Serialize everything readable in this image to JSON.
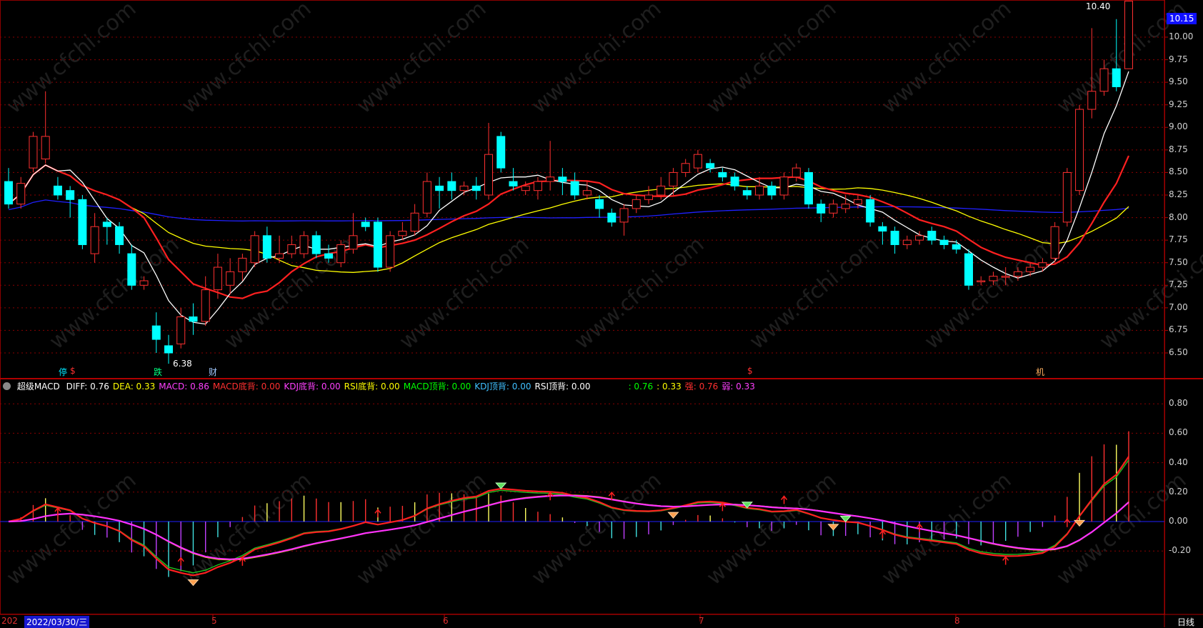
{
  "price_panel": {
    "high_marker": "10.40",
    "low_marker": "6.38",
    "current_price": "10.15",
    "y_axis": [
      "10.00",
      "9.75",
      "9.50",
      "9.25",
      "9.00",
      "8.75",
      "8.50",
      "8.25",
      "8.00",
      "7.75",
      "7.50",
      "7.25",
      "7.00",
      "6.75",
      "6.50"
    ],
    "signal_labels": [
      {
        "text": "停",
        "color": "#00e5ff"
      },
      {
        "text": "$",
        "color": "#ff3030"
      },
      {
        "text": "跌",
        "color": "#00ff80"
      },
      {
        "text": "财",
        "color": "#a0c8ff"
      },
      {
        "text": "$",
        "color": "#ff3030"
      },
      {
        "text": "机",
        "color": "#ffb060"
      }
    ],
    "watermark": "www.cfchi.com"
  },
  "indicator_panel": {
    "name": "超级MACD",
    "stats": [
      {
        "label": "DIFF: 0.76",
        "color": "#ffffff"
      },
      {
        "label": "DEA: 0.33",
        "color": "#ffff00"
      },
      {
        "label": "MACD: 0.86",
        "color": "#ff40ff"
      },
      {
        "label": "MACD底背: 0.00",
        "color": "#ff3030"
      },
      {
        "label": "KDJ底背: 0.00",
        "color": "#ff40ff"
      },
      {
        "label": "RSI底背: 0.00",
        "color": "#ffff00"
      },
      {
        "label": "MACD顶背: 0.00",
        "color": "#00ff00"
      },
      {
        "label": "KDJ顶背: 0.00",
        "color": "#40c0ff"
      },
      {
        "label": "RSI顶背: 0.00",
        "color": "#ffffff"
      },
      {
        "label": ": 0.76",
        "color": "#00ff00"
      },
      {
        "label": ": 0.33",
        "color": "#ffff00"
      },
      {
        "label": "强: 0.76",
        "color": "#ff3030"
      },
      {
        "label": "弱: 0.33",
        "color": "#ff40ff"
      }
    ],
    "y_axis": [
      "0.80",
      "0.60",
      "0.40",
      "0.20",
      "0.00",
      "-0.20"
    ]
  },
  "bottom_bar": {
    "date_prefix": "202",
    "date": "2022/03/30/三",
    "months": [
      "5",
      "6",
      "7",
      "8"
    ],
    "period": "日线"
  },
  "colors": {
    "up": "#ff3030",
    "down": "#00ffff",
    "ma5": "#ffffff",
    "ma10": "#ff2020",
    "ma20": "#ffff00",
    "ma60": "#2020ff",
    "grid": "#8b0000"
  },
  "chart_data": {
    "type": "candlestick",
    "y_range": [
      6.38,
      10.4
    ],
    "candles": [
      [
        8.4,
        8.15,
        8.55,
        8.1
      ],
      [
        8.15,
        8.38,
        8.45,
        8.1
      ],
      [
        8.55,
        8.9,
        8.95,
        8.5
      ],
      [
        8.65,
        8.9,
        9.4,
        8.6
      ],
      [
        8.35,
        8.25,
        8.45,
        8.2
      ],
      [
        8.3,
        8.2,
        8.35,
        8.0
      ],
      [
        8.2,
        7.7,
        8.25,
        7.65
      ],
      [
        7.6,
        7.9,
        8.05,
        7.5
      ],
      [
        7.95,
        7.9,
        8.0,
        7.7
      ],
      [
        7.9,
        7.7,
        7.95,
        7.6
      ],
      [
        7.6,
        7.25,
        7.7,
        7.2
      ],
      [
        7.25,
        7.3,
        7.35,
        7.2
      ],
      [
        6.8,
        6.65,
        6.95,
        6.5
      ],
      [
        6.58,
        6.5,
        6.7,
        6.38
      ],
      [
        6.6,
        6.9,
        7.0,
        6.55
      ],
      [
        6.9,
        6.85,
        7.05,
        6.7
      ],
      [
        6.85,
        7.2,
        7.35,
        6.8
      ],
      [
        7.2,
        7.45,
        7.6,
        7.1
      ],
      [
        7.25,
        7.4,
        7.55,
        7.15
      ],
      [
        7.4,
        7.55,
        7.6,
        7.3
      ],
      [
        7.5,
        7.8,
        7.85,
        7.45
      ],
      [
        7.8,
        7.55,
        7.9,
        7.5
      ],
      [
        7.55,
        7.6,
        7.8,
        7.5
      ],
      [
        7.6,
        7.7,
        7.8,
        7.55
      ],
      [
        7.6,
        7.8,
        7.85,
        7.55
      ],
      [
        7.8,
        7.6,
        7.85,
        7.55
      ],
      [
        7.6,
        7.55,
        7.7,
        7.5
      ],
      [
        7.5,
        7.7,
        7.75,
        7.45
      ],
      [
        7.65,
        7.8,
        8.05,
        7.6
      ],
      [
        7.95,
        7.9,
        8.0,
        7.85
      ],
      [
        7.95,
        7.45,
        8.0,
        7.4
      ],
      [
        7.45,
        7.8,
        7.85,
        7.4
      ],
      [
        7.8,
        7.85,
        7.95,
        7.75
      ],
      [
        7.85,
        8.05,
        8.15,
        7.8
      ],
      [
        8.05,
        8.4,
        8.5,
        8.0
      ],
      [
        8.35,
        8.3,
        8.45,
        8.1
      ],
      [
        8.4,
        8.3,
        8.5,
        8.2
      ],
      [
        8.3,
        8.35,
        8.4,
        8.25
      ],
      [
        8.35,
        8.3,
        8.45,
        8.2
      ],
      [
        8.25,
        8.7,
        9.05,
        8.2
      ],
      [
        8.9,
        8.55,
        8.95,
        8.5
      ],
      [
        8.4,
        8.35,
        8.55,
        8.3
      ],
      [
        8.3,
        8.35,
        8.4,
        8.25
      ],
      [
        8.3,
        8.4,
        8.45,
        8.2
      ],
      [
        8.4,
        8.45,
        8.85,
        8.3
      ],
      [
        8.45,
        8.4,
        8.55,
        8.25
      ],
      [
        8.4,
        8.25,
        8.5,
        8.2
      ],
      [
        8.25,
        8.3,
        8.4,
        8.2
      ],
      [
        8.2,
        8.1,
        8.25,
        8.0
      ],
      [
        8.05,
        7.95,
        8.1,
        7.9
      ],
      [
        7.95,
        8.1,
        8.15,
        7.8
      ],
      [
        8.1,
        8.2,
        8.25,
        8.05
      ],
      [
        8.2,
        8.25,
        8.35,
        8.15
      ],
      [
        8.25,
        8.35,
        8.45,
        8.2
      ],
      [
        8.35,
        8.5,
        8.55,
        8.25
      ],
      [
        8.5,
        8.6,
        8.65,
        8.45
      ],
      [
        8.55,
        8.7,
        8.75,
        8.5
      ],
      [
        8.6,
        8.55,
        8.65,
        8.5
      ],
      [
        8.5,
        8.45,
        8.55,
        8.4
      ],
      [
        8.45,
        8.35,
        8.5,
        8.3
      ],
      [
        8.3,
        8.25,
        8.35,
        8.2
      ],
      [
        8.25,
        8.35,
        8.45,
        8.2
      ],
      [
        8.35,
        8.25,
        8.4,
        8.2
      ],
      [
        8.25,
        8.45,
        8.5,
        8.2
      ],
      [
        8.45,
        8.55,
        8.6,
        8.4
      ],
      [
        8.5,
        8.15,
        8.55,
        8.1
      ],
      [
        8.15,
        8.05,
        8.2,
        7.95
      ],
      [
        8.05,
        8.15,
        8.2,
        8.0
      ],
      [
        8.1,
        8.15,
        8.25,
        8.05
      ],
      [
        8.15,
        8.2,
        8.25,
        8.1
      ],
      [
        8.2,
        7.95,
        8.25,
        7.9
      ],
      [
        7.9,
        7.85,
        7.95,
        7.7
      ],
      [
        7.85,
        7.7,
        7.9,
        7.6
      ],
      [
        7.7,
        7.75,
        7.8,
        7.65
      ],
      [
        7.75,
        7.8,
        7.85,
        7.7
      ],
      [
        7.85,
        7.75,
        7.9,
        7.7
      ],
      [
        7.75,
        7.7,
        7.8,
        7.65
      ],
      [
        7.7,
        7.65,
        7.75,
        7.6
      ],
      [
        7.6,
        7.25,
        7.65,
        7.2
      ],
      [
        7.3,
        7.3,
        7.35,
        7.25
      ],
      [
        7.3,
        7.35,
        7.4,
        7.25
      ],
      [
        7.35,
        7.35,
        7.45,
        7.25
      ],
      [
        7.35,
        7.4,
        7.45,
        7.3
      ],
      [
        7.4,
        7.45,
        7.5,
        7.35
      ],
      [
        7.45,
        7.5,
        7.55,
        7.4
      ],
      [
        7.55,
        7.9,
        7.95,
        7.5
      ],
      [
        7.95,
        8.5,
        8.55,
        7.9
      ],
      [
        8.3,
        9.2,
        9.25,
        8.25
      ],
      [
        9.2,
        9.4,
        10.1,
        9.1
      ],
      [
        9.4,
        9.65,
        9.75,
        9.35
      ],
      [
        9.65,
        9.45,
        10.2,
        9.4
      ],
      [
        9.65,
        10.4,
        10.4,
        9.65
      ]
    ]
  }
}
